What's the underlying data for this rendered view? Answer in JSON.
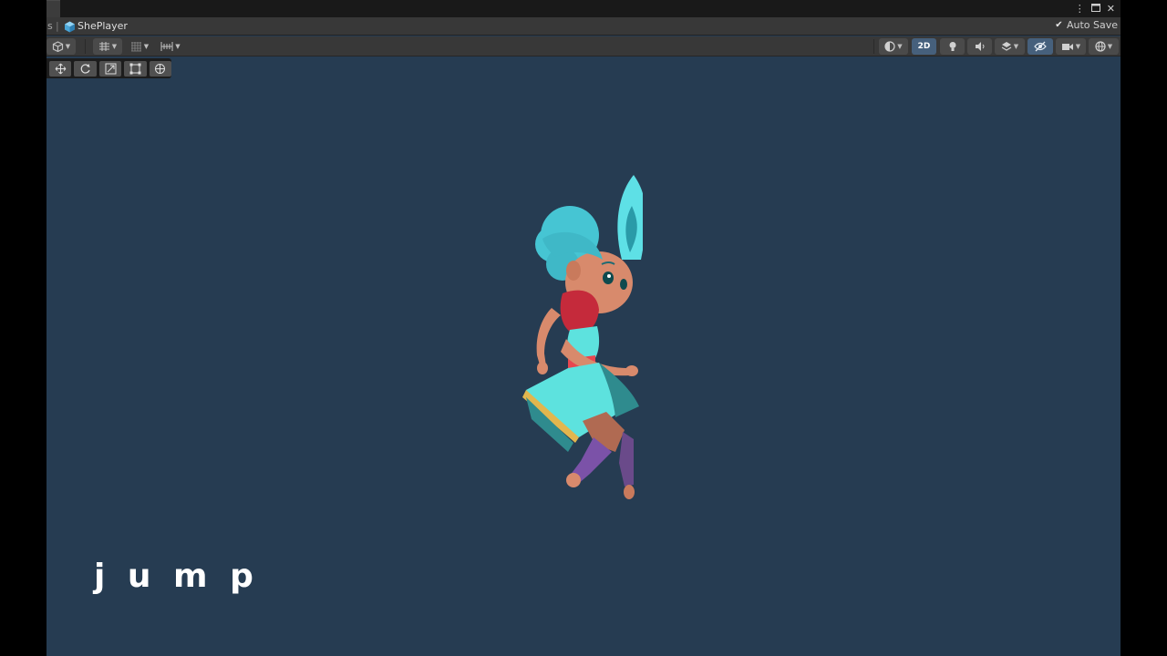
{
  "breadcrumb": {
    "previous": "s",
    "separator": "|",
    "current": "ShePlayer"
  },
  "window_controls": {
    "menu_icon": "kebab-icon",
    "maximize_icon": "maximize-icon",
    "close_icon": "close-icon"
  },
  "auto_save": {
    "label": "Auto Save",
    "checked": true
  },
  "toolbar": {
    "view_2d_label": "2D",
    "view_2d_active": true,
    "visibility_active": true
  },
  "colors": {
    "scene_background": "#263c52",
    "active_toggle": "#46607c",
    "caption": "#ffffff"
  },
  "caption": "j u m p"
}
